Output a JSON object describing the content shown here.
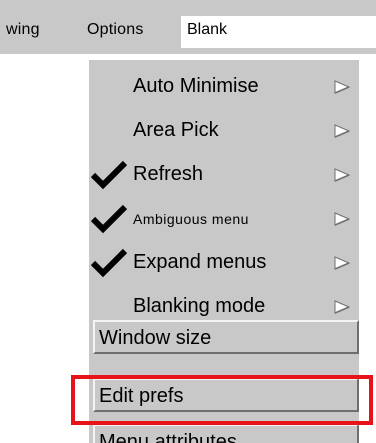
{
  "menubar": {
    "items": [
      "wing",
      "Options"
    ],
    "blank_value": "Blank"
  },
  "dropdown": {
    "items": [
      {
        "label": "Auto Minimise",
        "checked": false,
        "submenu": true,
        "small": false
      },
      {
        "label": "Area Pick",
        "checked": false,
        "submenu": true,
        "small": false
      },
      {
        "label": "Refresh",
        "checked": true,
        "submenu": true,
        "small": false
      },
      {
        "label": "Ambiguous menu",
        "checked": true,
        "submenu": true,
        "small": true
      },
      {
        "label": "Expand menus",
        "checked": true,
        "submenu": true,
        "small": false
      },
      {
        "label": "Blanking mode",
        "checked": false,
        "submenu": true,
        "small": false
      }
    ],
    "buttons": [
      "Window size",
      "Edit prefs",
      "Menu attributes"
    ]
  },
  "icons": {
    "check": "checkmark-icon",
    "submenu": "submenu-arrow-icon"
  },
  "colors": {
    "menu_bg": "#c8c8c8",
    "highlight": "#e8131a"
  },
  "highlighted_button": "Edit prefs"
}
